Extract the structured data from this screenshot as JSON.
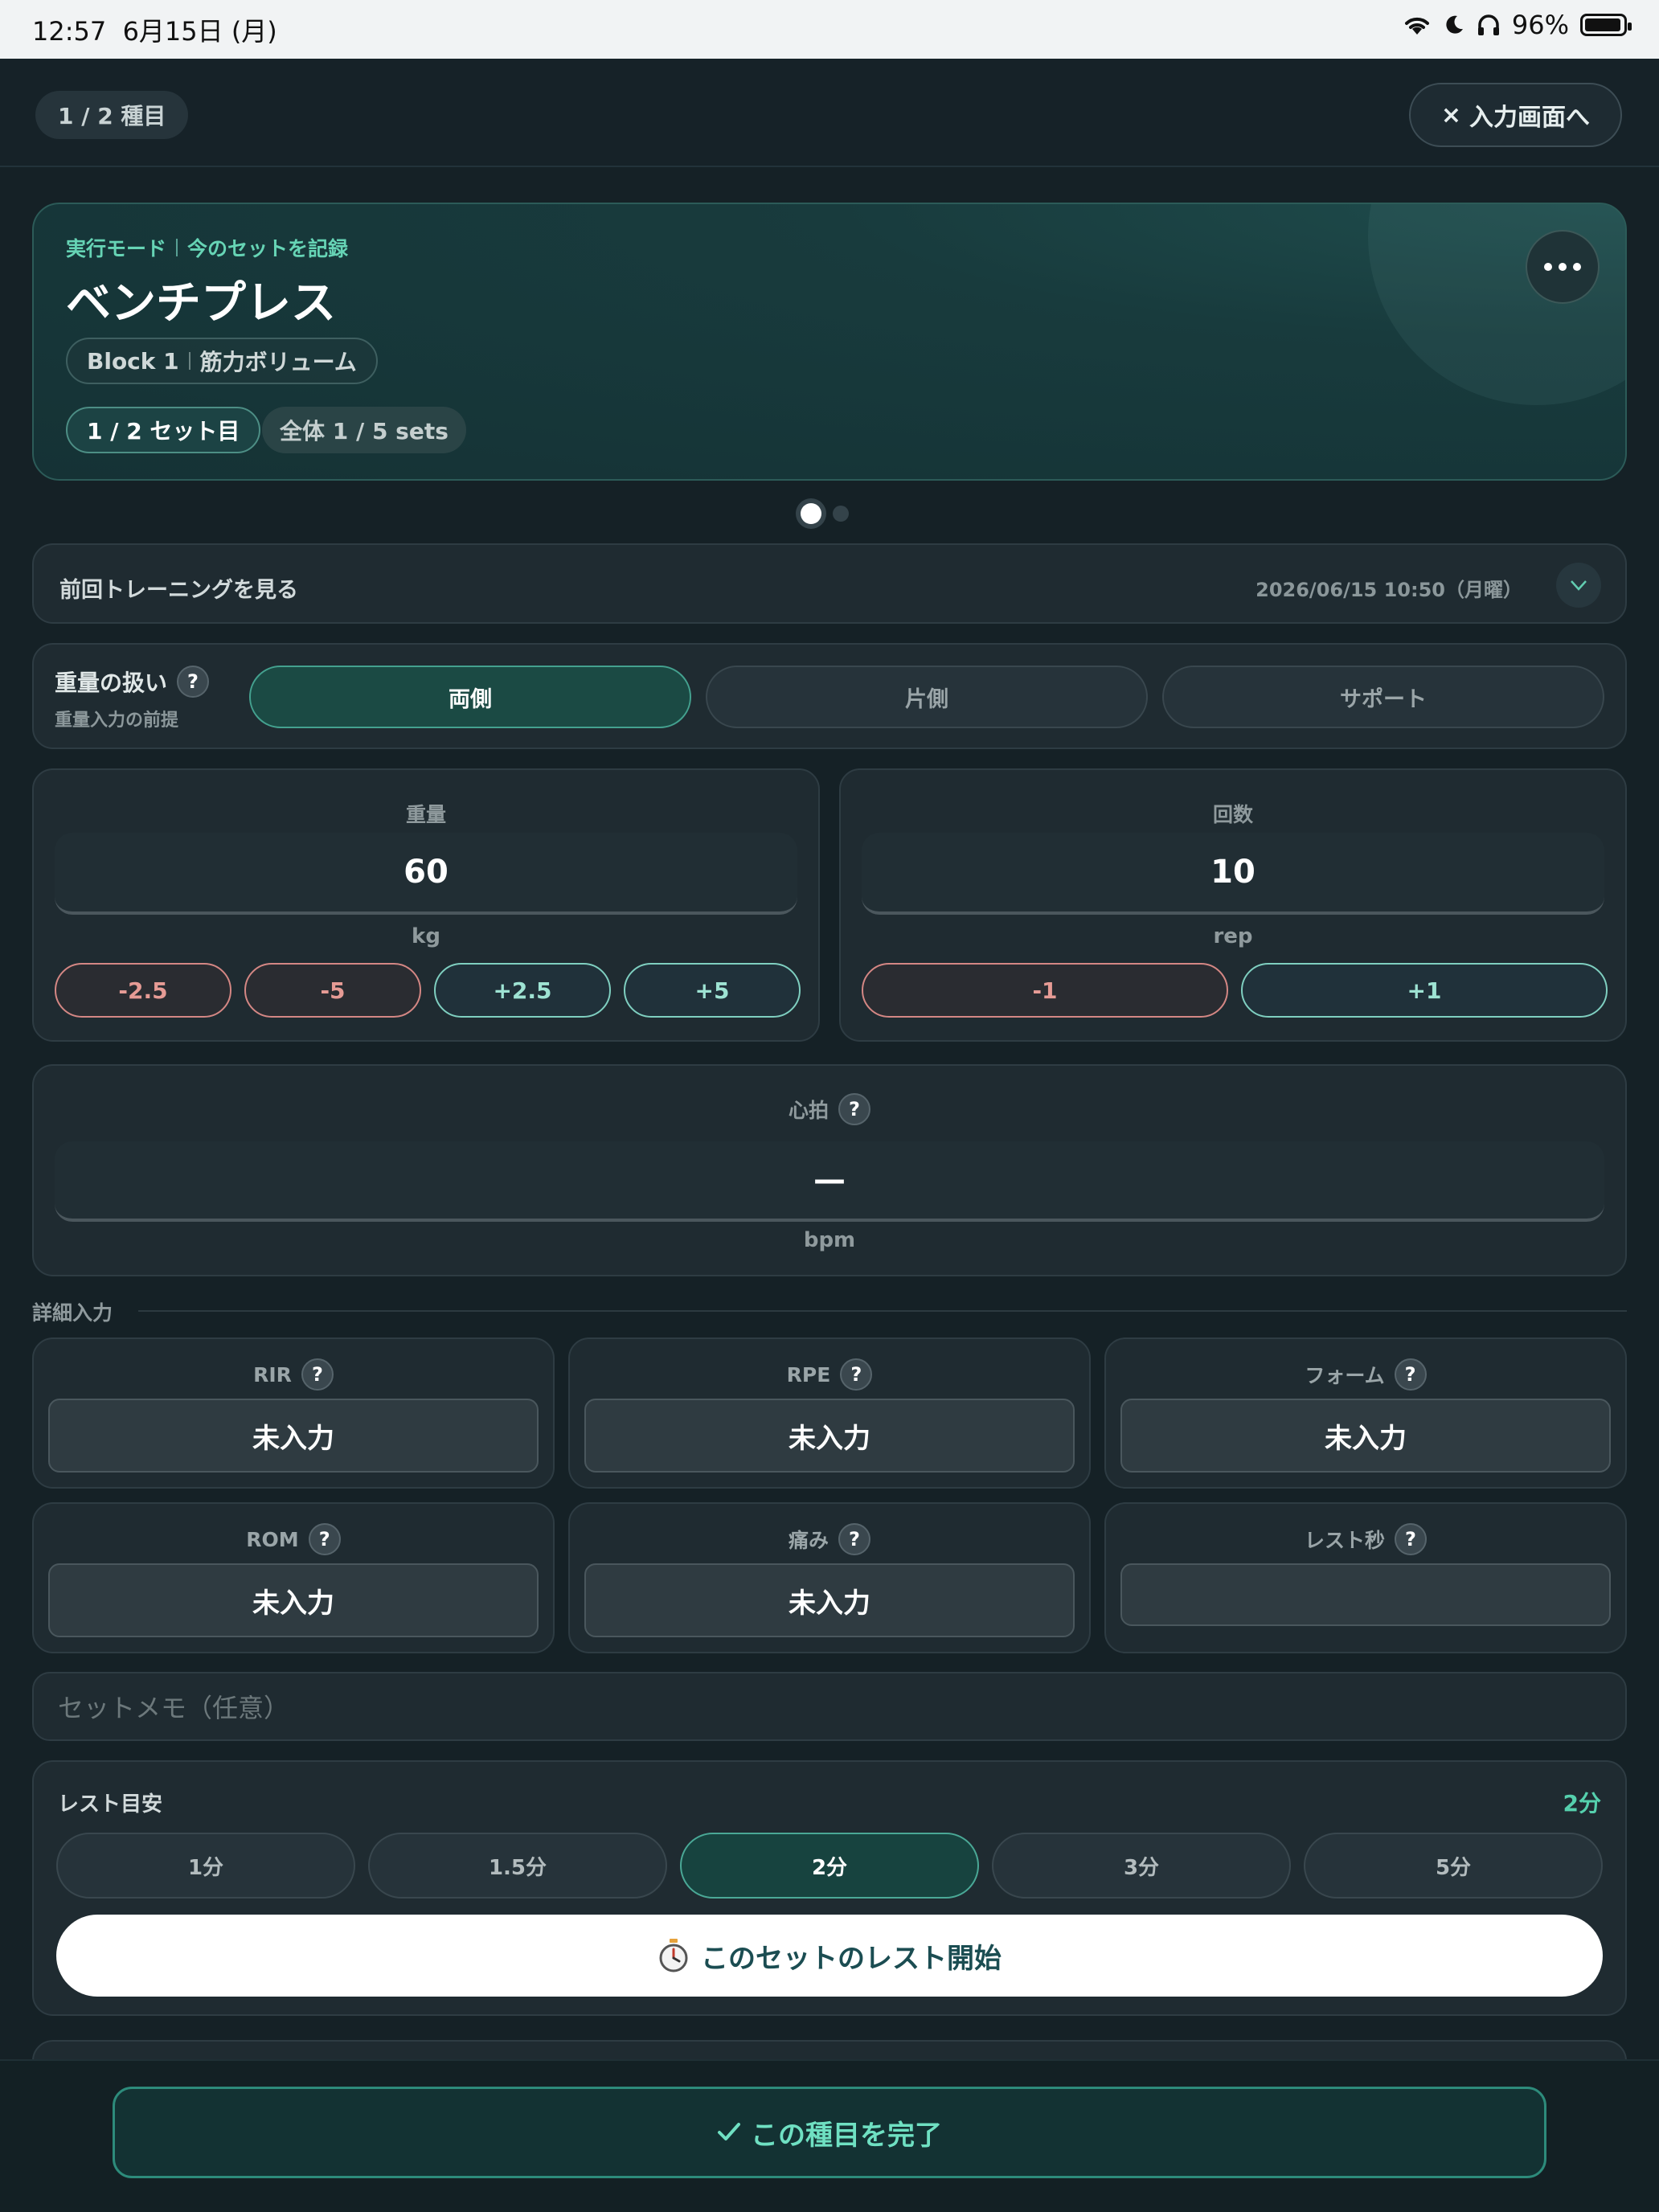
{
  "status_bar": {
    "time": "12:57",
    "date": "6月15日 (月)",
    "battery": "96%",
    "battery_level": 0.96
  },
  "top_bar": {
    "exercise_progress": "1 / 2 種目",
    "exit_label": "入力画面へ"
  },
  "hero": {
    "mode": "実行モード",
    "mode_sub": "今のセットを記録",
    "title": "ベンチプレス",
    "block": "Block 1",
    "block_name": "筋力ボリューム",
    "set_label": "1 / 2 セット目",
    "total_label": "全体 1 / 5 sets"
  },
  "pager": {
    "current": 1,
    "total": 2
  },
  "previous": {
    "label": "前回トレーニングを見る",
    "date": "2026/06/15 10:50（月曜）"
  },
  "handling": {
    "title": "重量の扱い",
    "subtitle": "重量入力の前提",
    "options": [
      "両側",
      "片側",
      "サポート"
    ],
    "selected": "両側"
  },
  "weight": {
    "label": "重量",
    "value": "60",
    "unit": "kg",
    "steps": [
      "-2.5",
      "-5",
      "+2.5",
      "+5"
    ]
  },
  "reps": {
    "label": "回数",
    "value": "10",
    "unit": "rep",
    "steps": [
      "-1",
      "+1"
    ]
  },
  "heart_rate": {
    "label": "心拍",
    "value": "—",
    "unit": "bpm"
  },
  "details": {
    "section_label": "詳細入力",
    "items": [
      {
        "label": "RIR",
        "value": "未入力"
      },
      {
        "label": "RPE",
        "value": "未入力"
      },
      {
        "label": "フォーム",
        "value": "未入力"
      },
      {
        "label": "ROM",
        "value": "未入力"
      },
      {
        "label": "痛み",
        "value": "未入力"
      },
      {
        "label": "レスト秒",
        "value": ""
      }
    ]
  },
  "memo": {
    "placeholder": "セットメモ（任意）"
  },
  "rest": {
    "label": "レスト目安",
    "current": "2分",
    "options": [
      "1分",
      "1.5分",
      "2分",
      "3分",
      "5分"
    ],
    "selected": "2分",
    "start_label": "このセットのレスト開始"
  },
  "footer": {
    "complete_label": "この種目を完了"
  },
  "help_symbol": "?"
}
